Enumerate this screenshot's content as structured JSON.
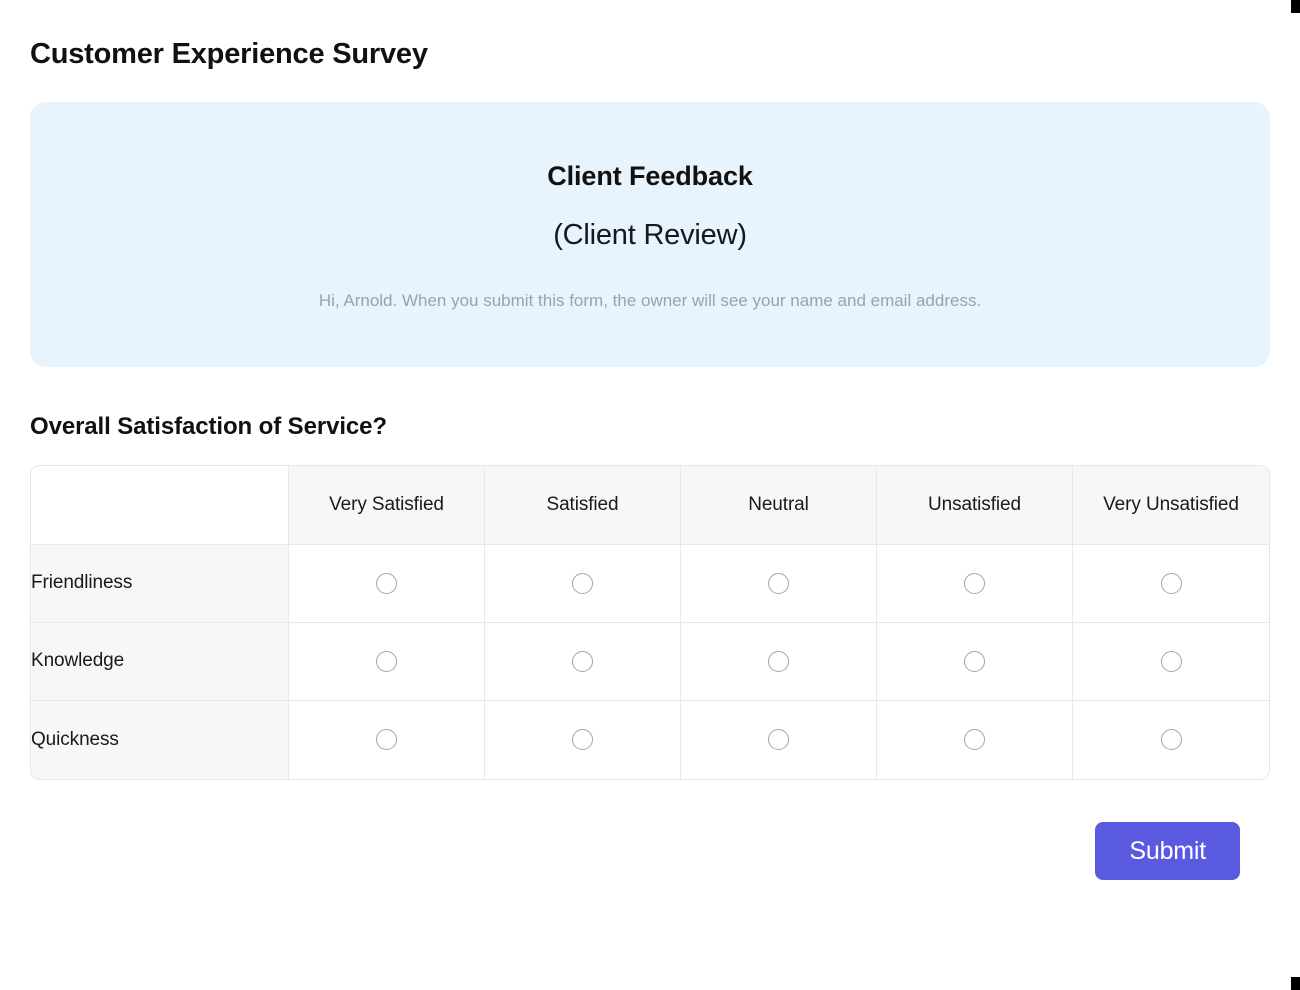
{
  "page": {
    "title": "Customer Experience Survey"
  },
  "banner": {
    "title": "Client Feedback",
    "subtitle": "(Client Review)",
    "note": "Hi, Arnold. When you submit this form, the owner will see your name and email address.",
    "background_color": "#e7f3fd"
  },
  "question": {
    "title": "Overall Satisfaction of Service?",
    "corner_label": "",
    "columns": [
      "Very Satisfied",
      "Satisfied",
      "Neutral",
      "Unsatisfied",
      "Very Unsatisfied"
    ],
    "rows": [
      {
        "label": "Friendliness",
        "selected": -1
      },
      {
        "label": "Knowledge",
        "selected": -1
      },
      {
        "label": "Quickness",
        "selected": -1
      }
    ]
  },
  "actions": {
    "submit_label": "Submit",
    "submit_color": "#5a5ae0"
  }
}
